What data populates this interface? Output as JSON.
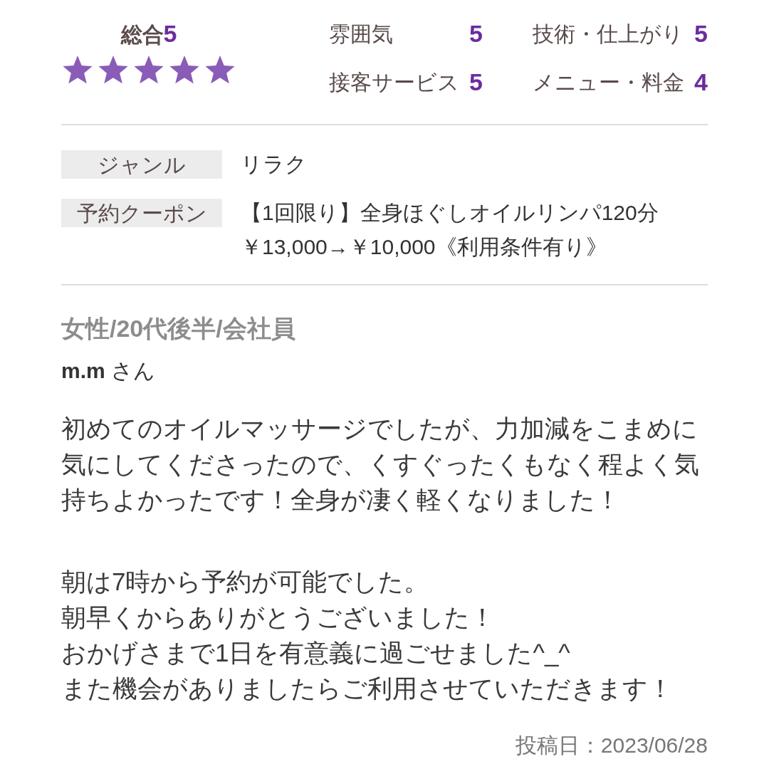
{
  "overall": {
    "label": "総合",
    "score": "5",
    "stars": 5
  },
  "ratings": [
    {
      "label": "雰囲気",
      "score": "5"
    },
    {
      "label": "技術・仕上がり",
      "score": "5"
    },
    {
      "label": "接客サービス",
      "score": "5"
    },
    {
      "label": "メニュー・料金",
      "score": "4"
    }
  ],
  "details": [
    {
      "label": "ジャンル",
      "lines": [
        "リラク"
      ]
    },
    {
      "label": "予約クーポン",
      "lines": [
        "【1回限り】全身ほぐしオイルリンパ120分",
        "￥13,000→￥10,000《利用条件有り》"
      ]
    }
  ],
  "reviewer": {
    "profile": "女性/20代後半/会社員",
    "name": "**m.m** さん"
  },
  "comment": [
    {
      "lines": [
        "初めてのオイルマッサージでしたが、力加減をこまめに気にしてくださったので、くすぐったくもなく程よく気持ちよかったです！全身が凄く軽くなりました！"
      ]
    },
    {
      "lines": [
        "朝は7時から予約が可能でした。",
        "朝早くからありがとうございました！",
        "おかげさまで1日を有意義に過ごせました^_^",
        "また機会がありましたらご利用させていただきます！"
      ]
    }
  ],
  "posted": "投稿日：2023/06/28"
}
